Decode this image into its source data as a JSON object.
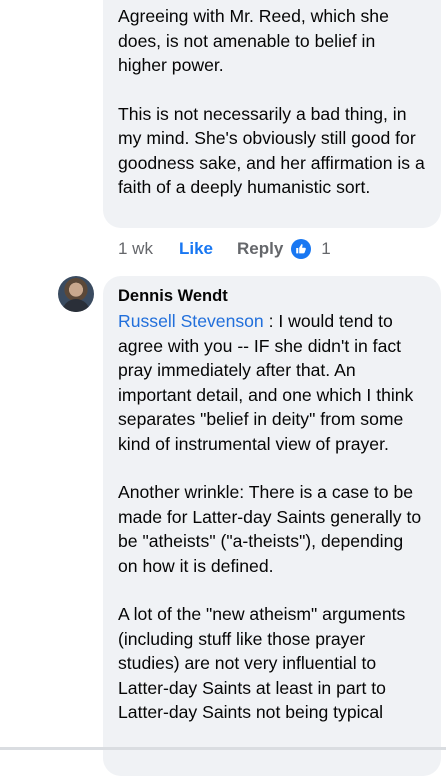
{
  "comment_top": {
    "paragraphs": [
      "Agreeing with Mr. Reed, which she does, is not amenable to belief in higher power.",
      "This is not necessarily a bad thing, in my mind. She's obviously still good for goodness sake, and her affirmation is a faith of a deeply humanistic sort."
    ],
    "meta": {
      "time": "1 wk",
      "like_label": "Like",
      "reply_label": "Reply",
      "reaction_count": "1",
      "reaction_icon": "like-thumb-icon",
      "like_color": "#1877f2"
    }
  },
  "comment_reply": {
    "author": "Dennis Wendt",
    "mention": "Russell Stevenson",
    "first_paragraph_rest": " : I would tend to agree with you -- IF she didn't in fact pray immediately after that. An important detail, and one which I think separates \"belief in deity\" from some kind of instrumental view of prayer.",
    "paragraphs": [
      "Another wrinkle: There is a case to be made for Latter-day Saints generally to be \"atheists\" (\"a-theists\"), depending on how it is defined.",
      "A lot of the \"new atheism\" arguments (including stuff like those prayer studies) are not very influential to Latter-day Saints at least in part to Latter-day Saints not being typical"
    ],
    "avatar_icon": "user-avatar"
  },
  "colors": {
    "bubble_bg": "#f0f2f5",
    "mention": "#216fdb",
    "meta_gray": "#65676b"
  }
}
